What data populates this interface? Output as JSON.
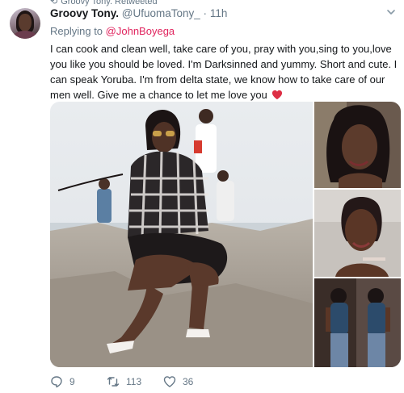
{
  "context": {
    "text": "Groovy Tony. Retweeted"
  },
  "tweet": {
    "display_name": "Groovy Tony.",
    "handle": "@UfuomaTony_",
    "separator": "·",
    "time": "11h",
    "reply_prefix": "Replying to",
    "reply_to": "@JohnBoyega",
    "text": "I can cook and clean well, take care of you, pray with you,sing to you,love you like you should be loved. I'm Darksinned and yummy. Short and cute. I can speak Yoruba. I'm from delta state, we know how to take care of our men well. Give me a chance to let me love you",
    "emoji": "heart",
    "accent_color": "#e0245e"
  },
  "actions": {
    "reply_icon": "reply-icon",
    "reply_count": "9",
    "retweet_icon": "retweet-icon",
    "retweet_count": "113",
    "like_icon": "heart-icon",
    "like_count": "36"
  }
}
